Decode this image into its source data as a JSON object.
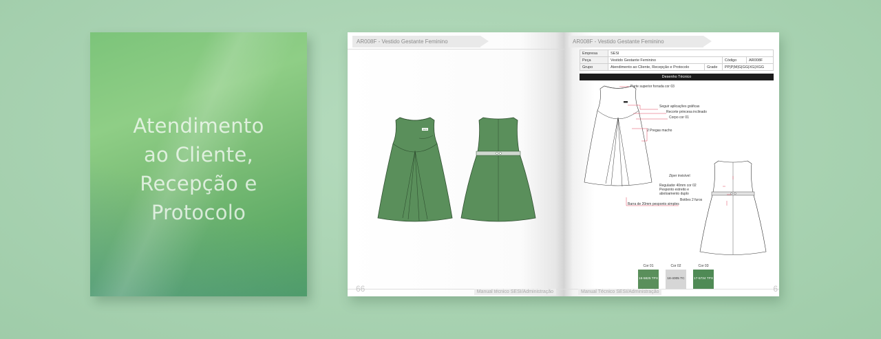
{
  "cover": {
    "title": "Atendimento\nao Cliente,\nRecepção e\nProtocolo"
  },
  "left_page": {
    "header": "AR008F - Vestido Gestante Feminino",
    "page_number": "66",
    "footer": "Manual técnico SESI/Administração",
    "logo_text": "SESI",
    "garment_color": "#5a8f5b"
  },
  "right_page": {
    "header": "AR008F - Vestido Gestante Feminino",
    "page_number": "6",
    "footer": "Manual Técnico SESI/Administração",
    "spec": {
      "empresa_label": "Empresa",
      "empresa_value": "SESI",
      "peca_label": "Peça",
      "peca_value": "Vestido Gestante Feminino",
      "codigo_label": "Código",
      "codigo_value": "AR008F",
      "grupo_label": "Grupo",
      "grupo_value": "Atendimento ao Cliente, Recepção e Protocolo",
      "grade_label": "Grade",
      "grade_value": "PP|P|M|G|GG|XG|XGG"
    },
    "section_title": "Desenho Técnico",
    "annotations": {
      "parte_superior": "Parte superior forrada cor 03",
      "aplicacoes": "Seguir aplicações gráficas",
      "recorte": "Recorte princesa inclinado",
      "corpo": "Corpo cor 01",
      "pregas": "2 Pregas macho",
      "ziper": "Ziper invisível",
      "regulador": "Regulador 40mm cor 02",
      "pesponto": "Pesponto estreito e",
      "abotoamento": "abotoamento duplo",
      "botoes": "Botões 2 furos",
      "barra": "Barra de 20mm pesponto simples"
    },
    "swatches": [
      {
        "label": "Cor 01",
        "code": "16-5825 TPX",
        "color": "#5a8f5b",
        "text_color": "#ffffff"
      },
      {
        "label": "Cor 02",
        "code": "18-4005 TC",
        "color": "#d6d6d6",
        "text_color": "#333333"
      },
      {
        "label": "Cor 03",
        "code": "17-5734 TPX",
        "color": "#4f8a55",
        "text_color": "#ffffff"
      }
    ]
  }
}
